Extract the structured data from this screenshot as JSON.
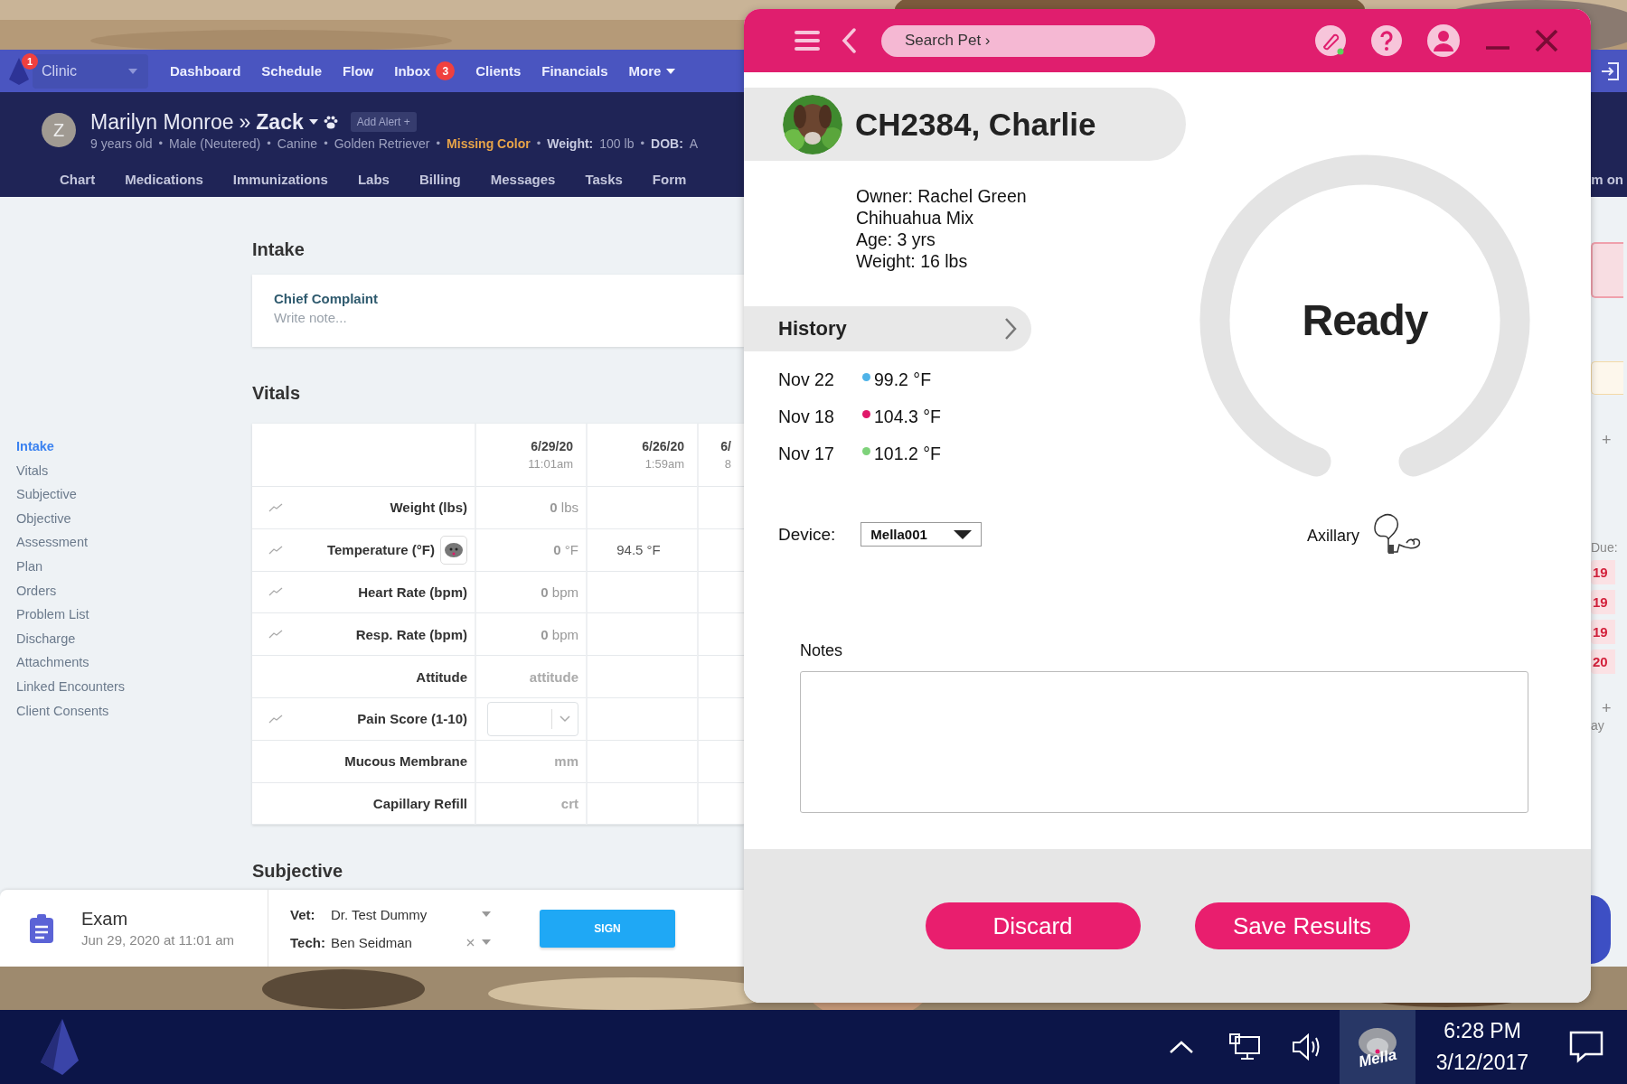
{
  "web_app": {
    "nav": {
      "notification_count": "1",
      "clinic": "Clinic",
      "links": [
        {
          "label": "Dashboard",
          "kind": "link"
        },
        {
          "label": "Schedule",
          "kind": "link"
        },
        {
          "label": "Flow",
          "kind": "link"
        },
        {
          "label": "Inbox",
          "kind": "link",
          "badge": "3"
        },
        {
          "label": "Clients",
          "kind": "link"
        },
        {
          "label": "Financials",
          "kind": "link"
        },
        {
          "label": "More",
          "kind": "menu"
        }
      ]
    },
    "patient": {
      "bullet": "•",
      "avatar_letter": "Z",
      "owner": "Marilyn Monroe",
      "separator": "»",
      "pet": "Zack",
      "alert_button": "Add Alert +",
      "details": [
        {
          "text": "9 years old",
          "kind": "plain"
        },
        {
          "text": "Male (Neutered)",
          "kind": "plain"
        },
        {
          "text": "Canine",
          "kind": "plain"
        },
        {
          "text": "Golden Retriever",
          "kind": "plain"
        },
        {
          "text": "Missing Color",
          "kind": "warning"
        },
        {
          "label": "Weight:",
          "text": "100 lb",
          "kind": "plain"
        },
        {
          "label": "DOB:",
          "text": "A",
          "kind": "plain"
        }
      ]
    },
    "tabs": [
      "Chart",
      "Medications",
      "Immunizations",
      "Labs",
      "Billing",
      "Messages",
      "Tasks",
      "Form"
    ],
    "sections_nav": [
      {
        "label": "Intake",
        "selected": true
      },
      {
        "label": "Vitals",
        "selected": false
      },
      {
        "label": "Subjective",
        "selected": false
      },
      {
        "label": "Objective",
        "selected": false
      },
      {
        "label": "Assessment",
        "selected": false
      },
      {
        "label": "Plan",
        "selected": false
      },
      {
        "label": "Orders",
        "selected": false
      },
      {
        "label": "Problem List",
        "selected": false
      },
      {
        "label": "Discharge",
        "selected": false
      },
      {
        "label": "Attachments",
        "selected": false
      },
      {
        "label": "Linked Encounters",
        "selected": false
      },
      {
        "label": "Client Consents",
        "selected": false
      }
    ],
    "intake": {
      "title": "Intake",
      "chief_complaint": {
        "label": "Chief Complaint",
        "placeholder": "Write note..."
      }
    },
    "vitals": {
      "title": "Vitals",
      "columns": [
        {
          "date": "6/29/20",
          "time": "11:01am"
        },
        {
          "date": "6/26/20",
          "time": "1:59am"
        },
        {
          "date": "6/",
          "time": "8"
        }
      ],
      "rows": [
        {
          "label": "Weight (lbs)",
          "trend": true,
          "device_icon": false,
          "kind": "value",
          "value": "**0** lbs"
        },
        {
          "label": "Temperature (°F)",
          "trend": true,
          "device_icon": true,
          "kind": "value",
          "value": "**0** °F",
          "previous": "94.5 °F"
        },
        {
          "label": "Heart Rate (bpm)",
          "trend": true,
          "device_icon": false,
          "kind": "value",
          "value": "**0** bpm"
        },
        {
          "label": "Resp. Rate (bpm)",
          "trend": true,
          "device_icon": false,
          "kind": "value",
          "value": "**0** bpm"
        },
        {
          "label": "Attitude",
          "trend": false,
          "device_icon": false,
          "kind": "text",
          "placeholder": "attitude"
        },
        {
          "label": "Pain Score (1-10)",
          "trend": true,
          "device_icon": false,
          "kind": "select"
        },
        {
          "label": "Mucous Membrane",
          "trend": false,
          "device_icon": false,
          "kind": "text",
          "placeholder": "mm"
        },
        {
          "label": "Capillary Refill",
          "trend": false,
          "device_icon": false,
          "kind": "text",
          "placeholder": "crt"
        }
      ]
    },
    "subjective_title": "Subjective",
    "encounter": {
      "title": "Exam",
      "datetime": "Jun 29, 2020 at 11:01 am",
      "vet_label": "Vet:",
      "vet": "Dr. Test Dummy",
      "tech_label": "Tech:",
      "tech": "Ben Seidman",
      "sign_button": "SIGN"
    },
    "right_edge": {
      "tab_fragment": "m on",
      "add_buttons": [
        "+",
        "+"
      ],
      "due_label": "Due:",
      "due_dates": [
        "19",
        "19",
        "19",
        "20"
      ],
      "fragment": "ay"
    }
  },
  "mella_window": {
    "search": {
      "placeholder": "Search Pet ›"
    },
    "pet": {
      "name": "CH2384, Charlie",
      "info": [
        "Owner: Rachel Green",
        "Chihuahua Mix",
        "Age: 3 yrs",
        "Weight: 16 lbs"
      ]
    },
    "history": {
      "title": "History",
      "entries": [
        {
          "date": "Nov 22",
          "reading": "99.2 °F",
          "color": "#4fb3e8"
        },
        {
          "date": "Nov 18",
          "reading": "104.3 °F",
          "color": "#e0186a"
        },
        {
          "date": "Nov 17",
          "reading": "101.2 °F",
          "color": "#7ed27a"
        }
      ]
    },
    "status": "Ready",
    "device": {
      "label": "Device:",
      "value": "Mella001"
    },
    "position": "Axillary",
    "notes": {
      "label": "Notes"
    },
    "buttons": [
      "Discard",
      "Save Results"
    ]
  },
  "taskbar": {
    "tray_app": "Mella",
    "time": "6:28 PM",
    "date": "3/12/2017"
  }
}
